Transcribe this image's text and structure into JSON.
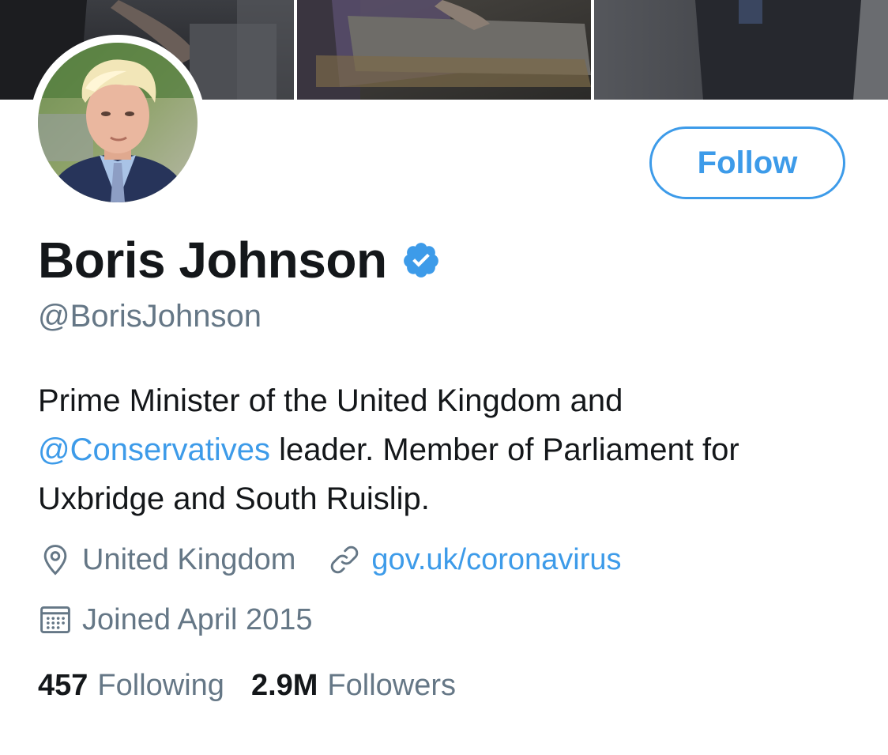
{
  "profile": {
    "display_name": "Boris Johnson",
    "handle": "@BorisJohnson",
    "verified": true,
    "follow_label": "Follow",
    "bio": {
      "line1": "Prime Minister of the United Kingdom and",
      "mention": "@Conservatives",
      "line2_rest": " leader. Member of Parliament for",
      "line3": "Uxbridge and South Ruislip."
    },
    "location": "United Kingdom",
    "website": "gov.uk/coronavirus",
    "joined": "Joined April 2015",
    "stats": {
      "following_count": "457",
      "following_label": "Following",
      "followers_count": "2.9M",
      "followers_label": "Followers"
    }
  },
  "icons": {
    "avatar": "profile-photo",
    "verified": "verified-badge-icon",
    "location": "location-pin-icon",
    "website": "link-icon",
    "joined": "calendar-icon"
  },
  "colors": {
    "accent": "#3d9be9",
    "text_primary": "#14171a",
    "text_secondary": "#657786"
  }
}
